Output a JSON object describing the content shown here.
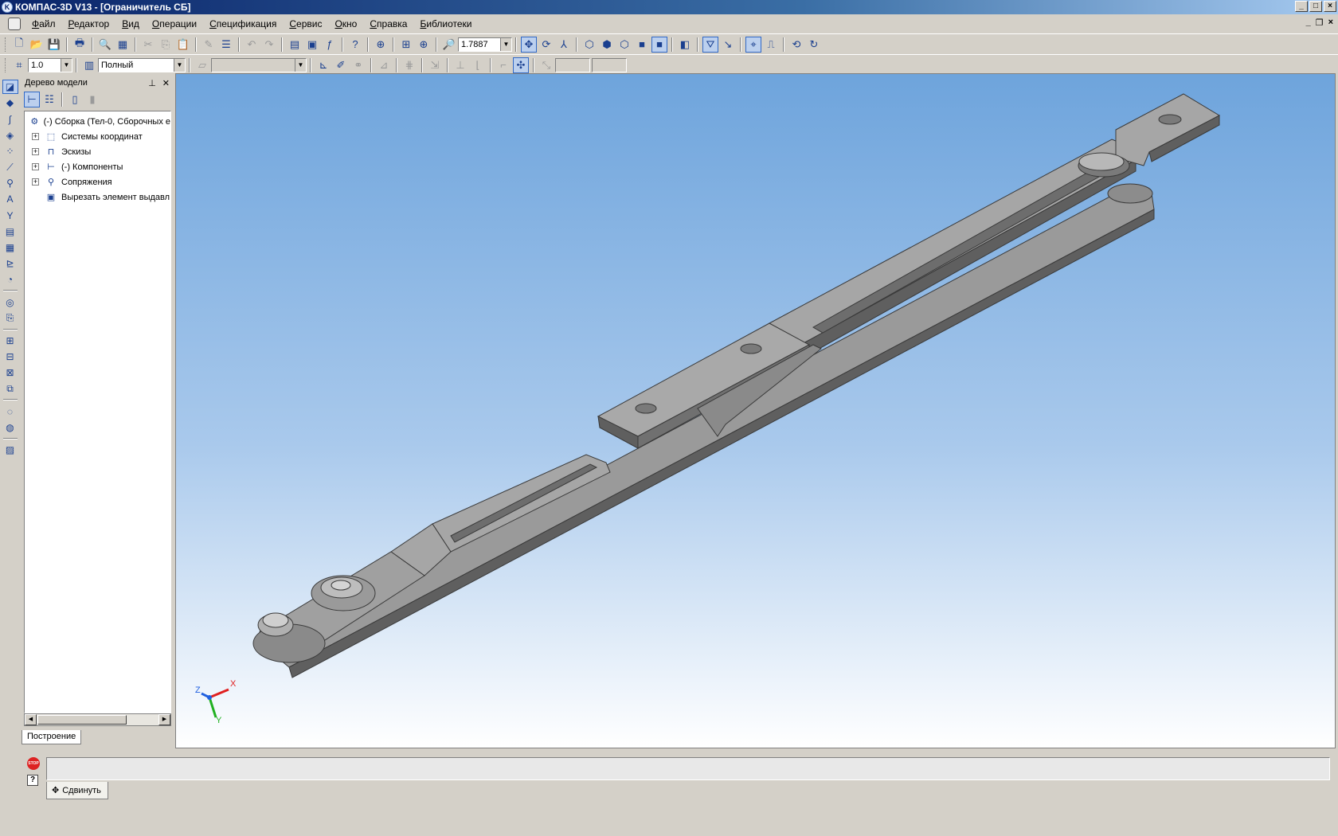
{
  "window": {
    "title": "КОМПАС-3D V13 - [Ограничитель СБ]",
    "app_icon": "K"
  },
  "menu": {
    "items": [
      "Файл",
      "Редактор",
      "Вид",
      "Операции",
      "Спецификация",
      "Сервис",
      "Окно",
      "Справка",
      "Библиотеки"
    ]
  },
  "toolbar": {
    "zoom_value": "1.7887",
    "step_value": "1.0",
    "display_mode": "Полный"
  },
  "panel": {
    "title": "Дерево модели",
    "tab_label": "Построение"
  },
  "tree": {
    "root": "(-) Сборка (Тел-0, Сборочных е",
    "items": [
      {
        "label": "Системы координат",
        "icon": "coordinate-systems-icon"
      },
      {
        "label": "Эскизы",
        "icon": "sketches-icon"
      },
      {
        "label": "(-) Компоненты",
        "icon": "components-icon"
      },
      {
        "label": "Сопряжения",
        "icon": "mates-icon"
      },
      {
        "label": "Вырезать элемент выдавл",
        "icon": "extrude-cut-icon"
      }
    ]
  },
  "axes": {
    "x": "X",
    "y": "Y",
    "z": "Z"
  },
  "status": {
    "stop_label": "STOP",
    "command_label": "Сдвинуть"
  },
  "colors": {
    "viewport_top": "#6ea4dc",
    "viewport_bottom": "#ffffff",
    "part_face": "#a6a6a6",
    "part_top": "#8c8c8c",
    "part_side": "#5f5f5f",
    "axis_x": "#e02020",
    "axis_y": "#20b020",
    "axis_z": "#2060e0"
  }
}
